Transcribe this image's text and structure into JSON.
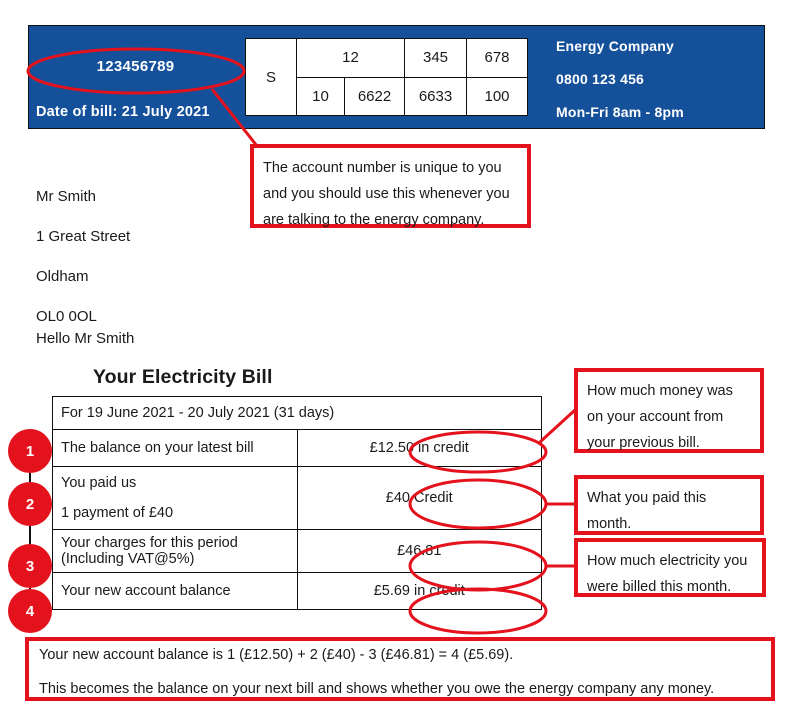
{
  "header": {
    "account_number": "123456789",
    "bill_date_label": "Date of bill: 21 July 2021",
    "mpan": {
      "profile": "S",
      "row_top": [
        "12",
        "345",
        "678"
      ],
      "row_bottom": [
        "10",
        "6622",
        "6633",
        "100"
      ]
    },
    "company": {
      "name": "Energy Company",
      "phone": "0800 123 456",
      "hours": "Mon-Fri 8am - 8pm"
    },
    "band_color": "#15519A"
  },
  "address": {
    "lines": [
      "Mr Smith",
      "1 Great Street",
      "Oldham",
      "OL0 0OL"
    ],
    "greeting": "Hello Mr Smith"
  },
  "bill": {
    "title": "Your Electricity Bill",
    "period": "For 19 June 2021 - 20 July 2021 (31 days)",
    "rows": [
      {
        "number": "1",
        "label": "The balance on your latest bill",
        "value": "£12.50 in credit"
      },
      {
        "number": "2",
        "label_line1": "You paid us",
        "label_line2": "1 payment of £40",
        "value": "£40 Credit"
      },
      {
        "number": "3",
        "label": "Your charges for this period (Including VAT@5%)",
        "value": "£46.81"
      },
      {
        "number": "4",
        "label": "Your new account balance",
        "value": "£5.69 in credit"
      }
    ]
  },
  "annotations": {
    "account": {
      "line1": "The account number is unique to you",
      "line2": "and you should use this whenever you",
      "line3": "are talking to the energy company."
    },
    "balance": {
      "line1": "How much money was",
      "line2": "on your account from",
      "line3": "your previous bill."
    },
    "paid": {
      "line1": "What you paid this",
      "line2": "month."
    },
    "charges": {
      "line1": "How much electricity you",
      "line2": "were billed this month."
    },
    "summary": {
      "line1": "Your new account balance is 1 (£12.50) + 2 (£40) - 3 (£46.81) = 4 (£5.69).",
      "line2": "This becomes the balance on your next bill and shows whether you owe the energy company any money."
    },
    "accent_color": "#E4121C"
  }
}
